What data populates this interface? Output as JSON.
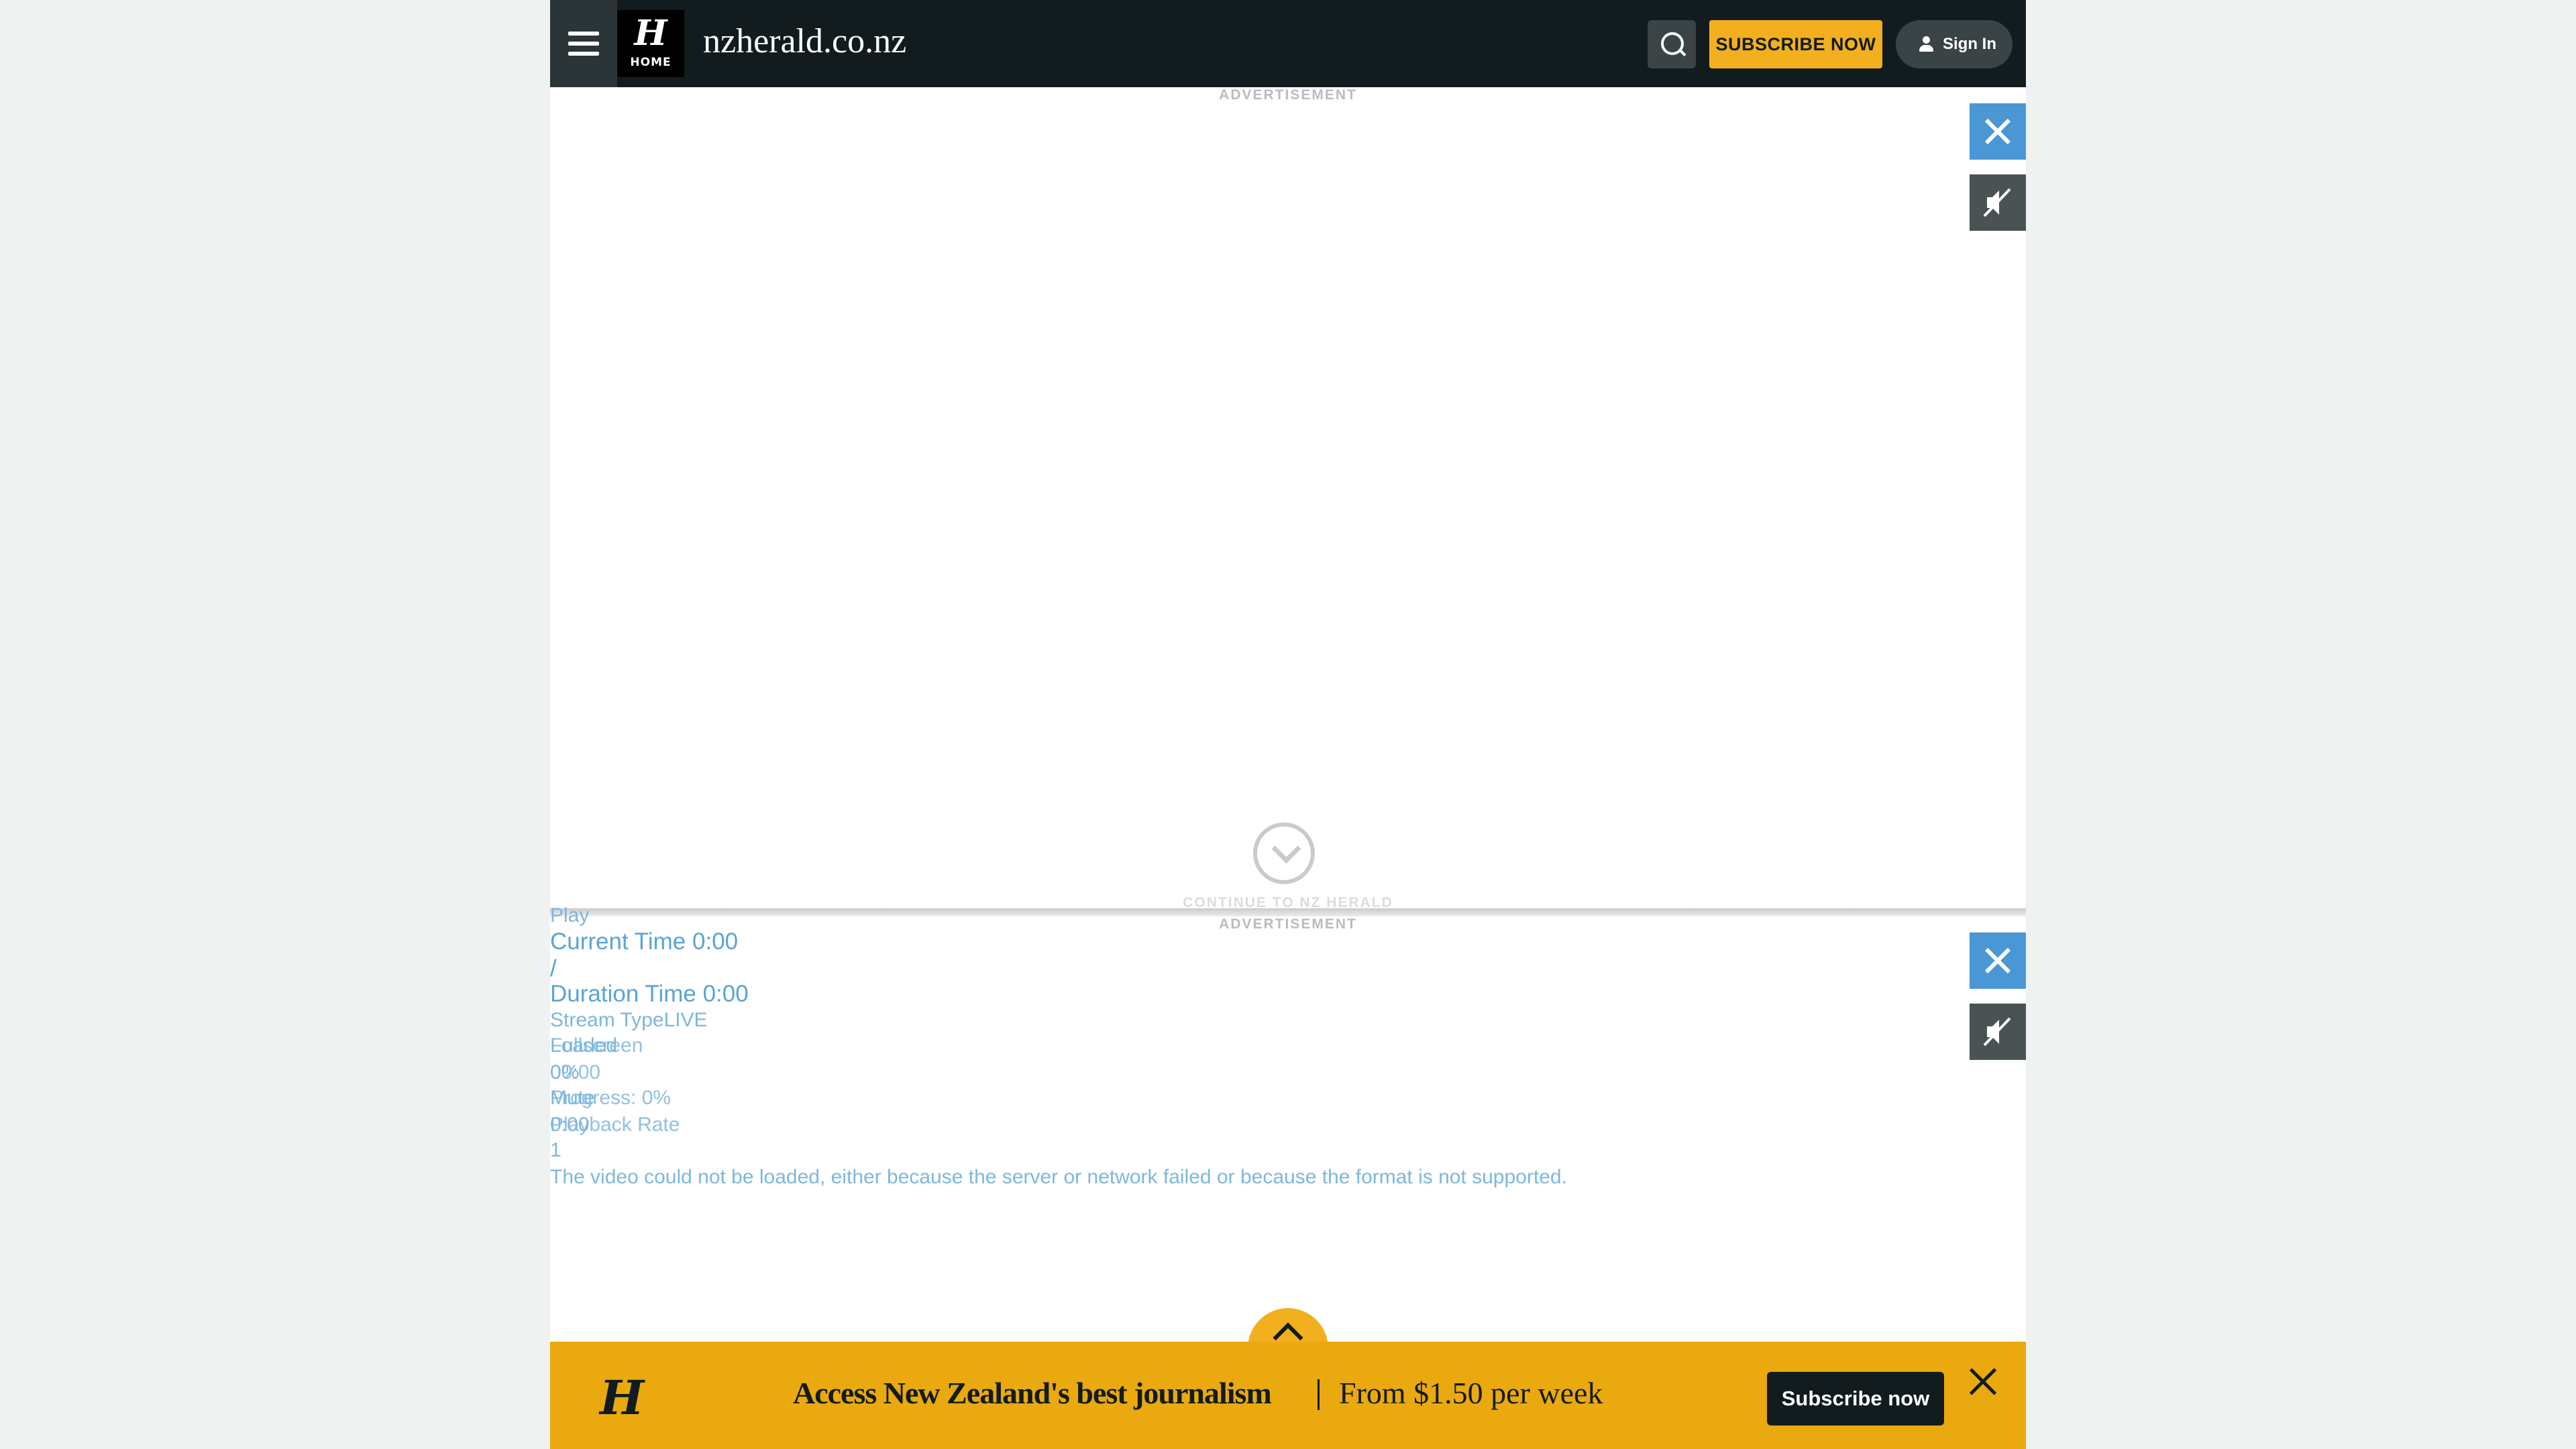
{
  "header": {
    "home_glyph": "H",
    "home_label": "HOME",
    "site_title": "nzherald.co.nz",
    "subscribe_label": "SUBSCRIBE NOW",
    "sign_in_label": "Sign In"
  },
  "ads": {
    "label": "ADVERTISEMENT",
    "continue_text": "CONTINUE TO NZ HERALD"
  },
  "video_player": {
    "play": "Play",
    "current_time": "Current Time 0:00",
    "slash": "/",
    "duration_time": "Duration Time 0:00",
    "stream_type": "Stream TypeLIVE",
    "loaded": "Loaded",
    "fullscreen": "Fullscreen",
    "loaded_pct": "0%",
    "time_zero": "00:00",
    "mute": "Mute",
    "progress": "Progress: 0%",
    "time_short": "0:00",
    "playback_rate": "Playback Rate",
    "rate_value": "1",
    "error": "The video could not be loaded, either because the server or network failed or because the format is not supported."
  },
  "banner": {
    "logo_glyph": "H",
    "headline": "Access New Zealand's best journalism",
    "price": "From $1.50 per week",
    "subscribe_label": "Subscribe now"
  },
  "colors": {
    "header_bg": "#121c1f",
    "accent_yellow": "#f2b01e",
    "banner_yellow": "#eaa90f",
    "ad_close_blue": "#4a97d6",
    "link_blue": "#5ba4d4"
  }
}
